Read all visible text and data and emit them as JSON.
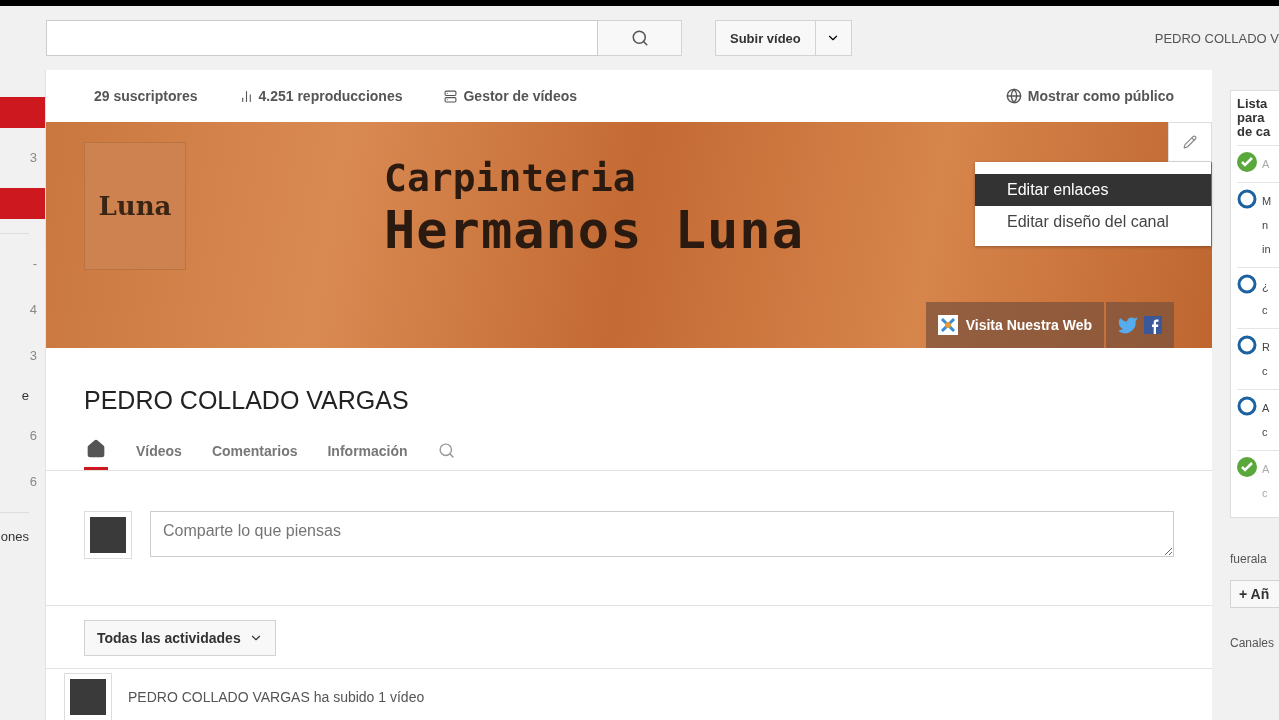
{
  "header": {
    "upload_button": "Subir vídeo",
    "user": "PEDRO COLLADO V"
  },
  "left_sidebar": [
    {
      "kind": "active"
    },
    {
      "kind": "count",
      "text": "3"
    },
    {
      "kind": "active"
    },
    {
      "kind": "divider"
    },
    {
      "kind": "count",
      "text": "-"
    },
    {
      "kind": "count",
      "text": "4"
    },
    {
      "kind": "count",
      "text": "3"
    },
    {
      "kind": "label",
      "text": "e"
    },
    {
      "kind": "count",
      "text": "6"
    },
    {
      "kind": "count",
      "text": "6"
    },
    {
      "kind": "divider"
    },
    {
      "kind": "label",
      "text": "ones"
    }
  ],
  "stats_bar": {
    "subscribers": "29 suscriptores",
    "views": "4.251 reproducciones",
    "manager": "Gestor de vídeos",
    "public_view": "Mostrar como público"
  },
  "banner": {
    "logo_text": "Luna",
    "title_line_1": "Carpinteria",
    "title_line_2": "Hermanos Luna",
    "website_link": "Visita Nuestra Web",
    "edit_menu": [
      {
        "label": "Editar enlaces",
        "selected": true
      },
      {
        "label": "Editar diseño del canal",
        "selected": false
      }
    ]
  },
  "channel": {
    "name": "PEDRO COLLADO VARGAS",
    "tabs": [
      {
        "kind": "home",
        "selected": true
      },
      {
        "kind": "text",
        "label": "Vídeos",
        "selected": false
      },
      {
        "kind": "text",
        "label": "Comentarios",
        "selected": false
      },
      {
        "kind": "text",
        "label": "Información",
        "selected": false
      },
      {
        "kind": "search",
        "selected": false
      }
    ],
    "share_placeholder": "Comparte lo que piensas",
    "activity_filter": "Todas las actividades",
    "activity": "PEDRO COLLADO VARGAS ha subido 1 vídeo"
  },
  "right_panel": {
    "checklist_title": "Lista para de ca",
    "items": [
      {
        "done": true,
        "lines": [
          "A"
        ]
      },
      {
        "done": false,
        "lines": [
          "M",
          "n",
          "in"
        ]
      },
      {
        "done": false,
        "lines": [
          "¿",
          "c"
        ]
      },
      {
        "done": false,
        "lines": [
          "R",
          "c"
        ]
      },
      {
        "done": false,
        "lines": [
          "A",
          "c"
        ]
      },
      {
        "done": true,
        "lines": [
          "A",
          "c"
        ]
      }
    ],
    "user_label": "fuerala",
    "add_button": "+ Añ",
    "channels_label": "Canales"
  }
}
